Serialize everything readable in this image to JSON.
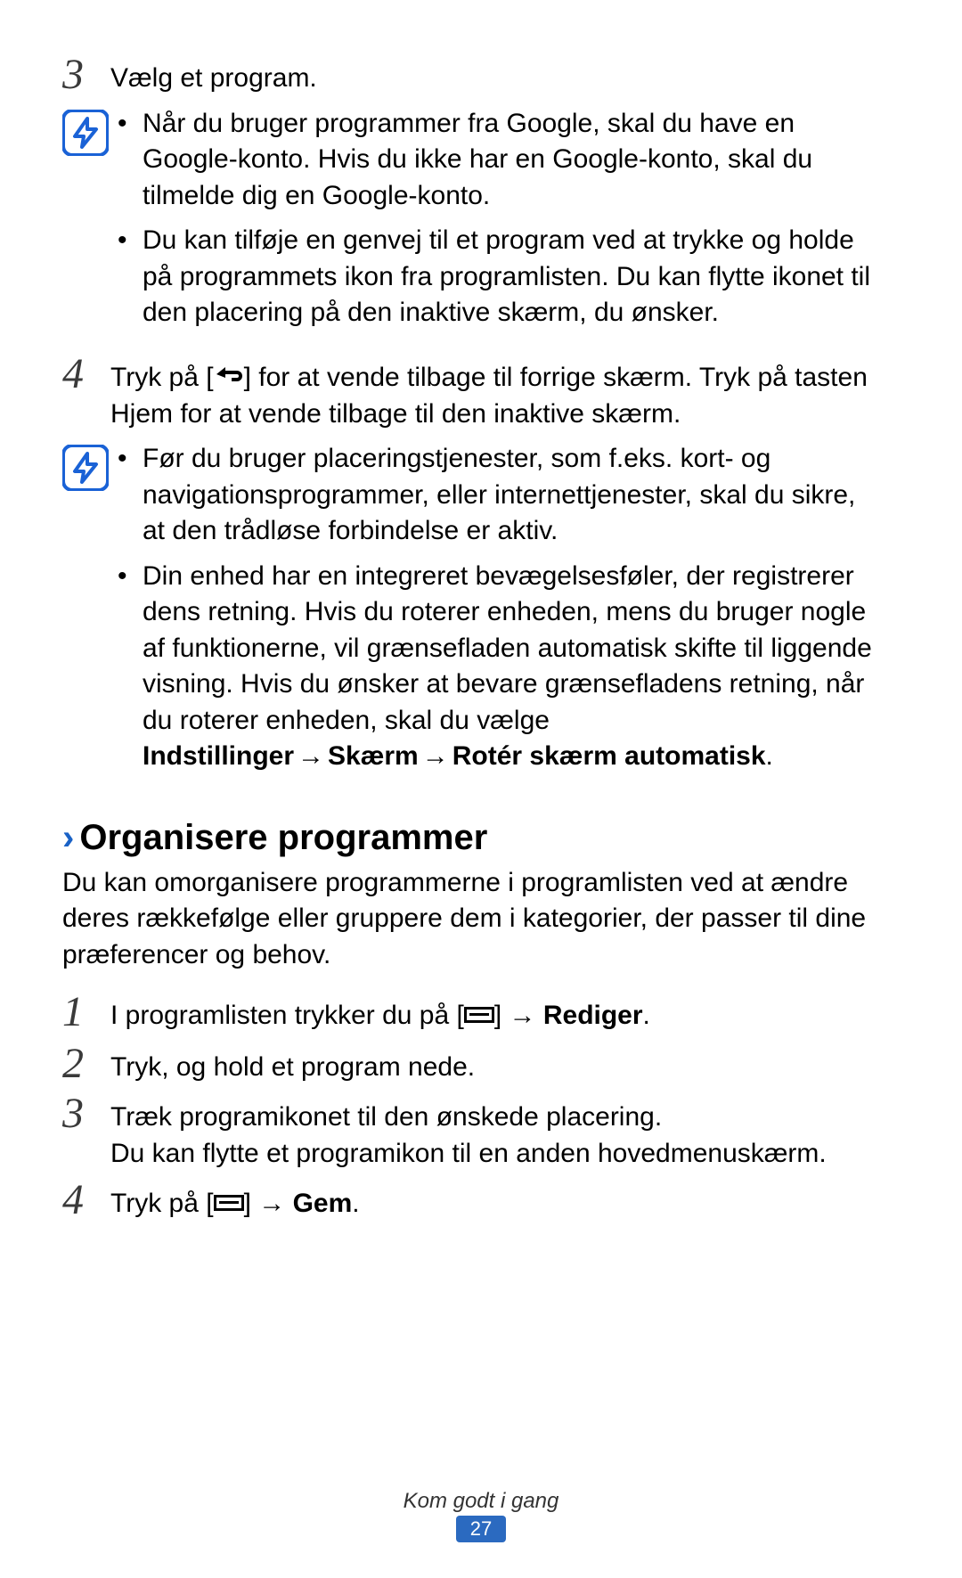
{
  "steps_top": {
    "num3": "3",
    "text3": "Vælg et program.",
    "num4": "4",
    "text4_a": "Tryk på [",
    "text4_b": "] for at vende tilbage til forrige skærm. Tryk på tasten Hjem for at vende tilbage til den inaktive skærm."
  },
  "note1": {
    "item1": "Når du bruger programmer fra Google, skal du have en Google-konto. Hvis du ikke har en Google-konto, skal du tilmelde dig en Google-konto.",
    "item2": "Du kan tilføje en genvej til et program ved at trykke og holde på programmets ikon fra programlisten. Du kan flytte ikonet til den placering på den inaktive skærm, du ønsker."
  },
  "note2": {
    "item1": "Før du bruger placeringstjenester, som f.eks. kort- og navigationsprogrammer, eller internettjenester, skal du sikre, at den trådløse forbindelse er aktiv.",
    "item2_a": "Din enhed har en integreret bevægelsesføler, der registrerer dens retning. Hvis du roterer enheden, mens du bruger nogle af funktionerne, vil grænsefladen automatisk skifte til liggende visning. Hvis du ønsker at bevare grænsefladens retning, når du roterer enheden, skal du vælge ",
    "item2_b1": "Indstillinger",
    "item2_b2": "Skærm",
    "item2_b3": "Rotér skærm automatisk",
    "item2_dot": "."
  },
  "section": {
    "title": "Organisere programmer",
    "intro": "Du kan omorganisere programmerne i programlisten ved at ændre deres rækkefølge eller gruppere dem i kategorier, der passer til dine præferencer og behov."
  },
  "steps_section": {
    "num1": "1",
    "s1_a": "I programlisten trykker du på [",
    "s1_b": "] → ",
    "s1_bold": "Rediger",
    "s1_dot": ".",
    "num2": "2",
    "s2": "Tryk, og hold et program nede.",
    "num3": "3",
    "s3_a": "Træk programikonet til den ønskede placering.",
    "s3_b": "Du kan flytte et programikon til en anden hovedmenuskærm.",
    "num4": "4",
    "s4_a": "Tryk på [",
    "s4_b": "] → ",
    "s4_bold": "Gem",
    "s4_dot": "."
  },
  "footer": {
    "text": "Kom godt i gang",
    "page": "27"
  },
  "arrow": "→"
}
